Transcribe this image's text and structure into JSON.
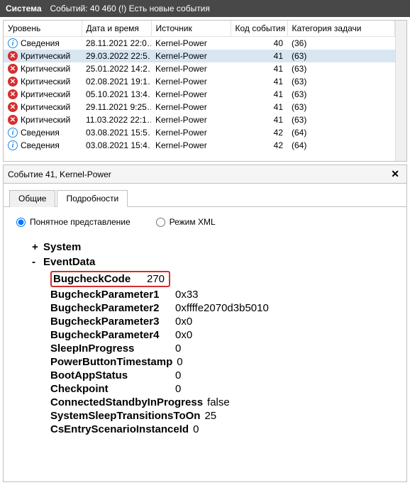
{
  "header": {
    "title": "Система",
    "count_text": "Событий: 40 460 (!) Есть новые события"
  },
  "columns": {
    "level": "Уровень",
    "datetime": "Дата и время",
    "source": "Источник",
    "event_id": "Код события",
    "task_category": "Категория задачи"
  },
  "events": [
    {
      "level": "Сведения",
      "icon": "info",
      "datetime": "28.11.2021 22:0…",
      "source": "Kernel-Power",
      "event_id": "40",
      "task_category": "(36)",
      "selected": false
    },
    {
      "level": "Критический",
      "icon": "critical",
      "datetime": "29.03.2022 22:5…",
      "source": "Kernel-Power",
      "event_id": "41",
      "task_category": "(63)",
      "selected": true
    },
    {
      "level": "Критический",
      "icon": "critical",
      "datetime": "25.01.2022 14:2…",
      "source": "Kernel-Power",
      "event_id": "41",
      "task_category": "(63)",
      "selected": false
    },
    {
      "level": "Критический",
      "icon": "critical",
      "datetime": "02.08.2021 19:1…",
      "source": "Kernel-Power",
      "event_id": "41",
      "task_category": "(63)",
      "selected": false
    },
    {
      "level": "Критический",
      "icon": "critical",
      "datetime": "05.10.2021 13:4…",
      "source": "Kernel-Power",
      "event_id": "41",
      "task_category": "(63)",
      "selected": false
    },
    {
      "level": "Критический",
      "icon": "critical",
      "datetime": "29.11.2021 9:25…",
      "source": "Kernel-Power",
      "event_id": "41",
      "task_category": "(63)",
      "selected": false
    },
    {
      "level": "Критический",
      "icon": "critical",
      "datetime": "11.03.2022 22:1…",
      "source": "Kernel-Power",
      "event_id": "41",
      "task_category": "(63)",
      "selected": false
    },
    {
      "level": "Сведения",
      "icon": "info",
      "datetime": "03.08.2021 15:5…",
      "source": "Kernel-Power",
      "event_id": "42",
      "task_category": "(64)",
      "selected": false
    },
    {
      "level": "Сведения",
      "icon": "info",
      "datetime": "03.08.2021 15:4…",
      "source": "Kernel-Power",
      "event_id": "42",
      "task_category": "(64)",
      "selected": false
    }
  ],
  "detail": {
    "title": "Событие 41, Kernel-Power",
    "tabs": {
      "general": "Общие",
      "details": "Подробности"
    },
    "view_modes": {
      "friendly": "Понятное представление",
      "xml": "Режим XML"
    },
    "tree": {
      "system_label": "System",
      "eventdata_label": "EventData"
    },
    "event_data": [
      {
        "key": "BugcheckCode",
        "val": "270",
        "highlight": true,
        "key_pad": "126"
      },
      {
        "key": "BugcheckParameter1",
        "val": "0x33"
      },
      {
        "key": "BugcheckParameter2",
        "val": "0xffffe2070d3b5010"
      },
      {
        "key": "BugcheckParameter3",
        "val": "0x0"
      },
      {
        "key": "BugcheckParameter4",
        "val": "0x0"
      },
      {
        "key": "SleepInProgress",
        "val": "0"
      },
      {
        "key": "PowerButtonTimestamp",
        "val": "0"
      },
      {
        "key": "BootAppStatus",
        "val": "0"
      },
      {
        "key": "Checkpoint",
        "val": "0"
      },
      {
        "key": "ConnectedStandbyInProgress",
        "val": "false"
      },
      {
        "key": "SystemSleepTransitionsToOn",
        "val": "25"
      },
      {
        "key": "CsEntryScenarioInstanceId",
        "val": "0"
      }
    ]
  }
}
